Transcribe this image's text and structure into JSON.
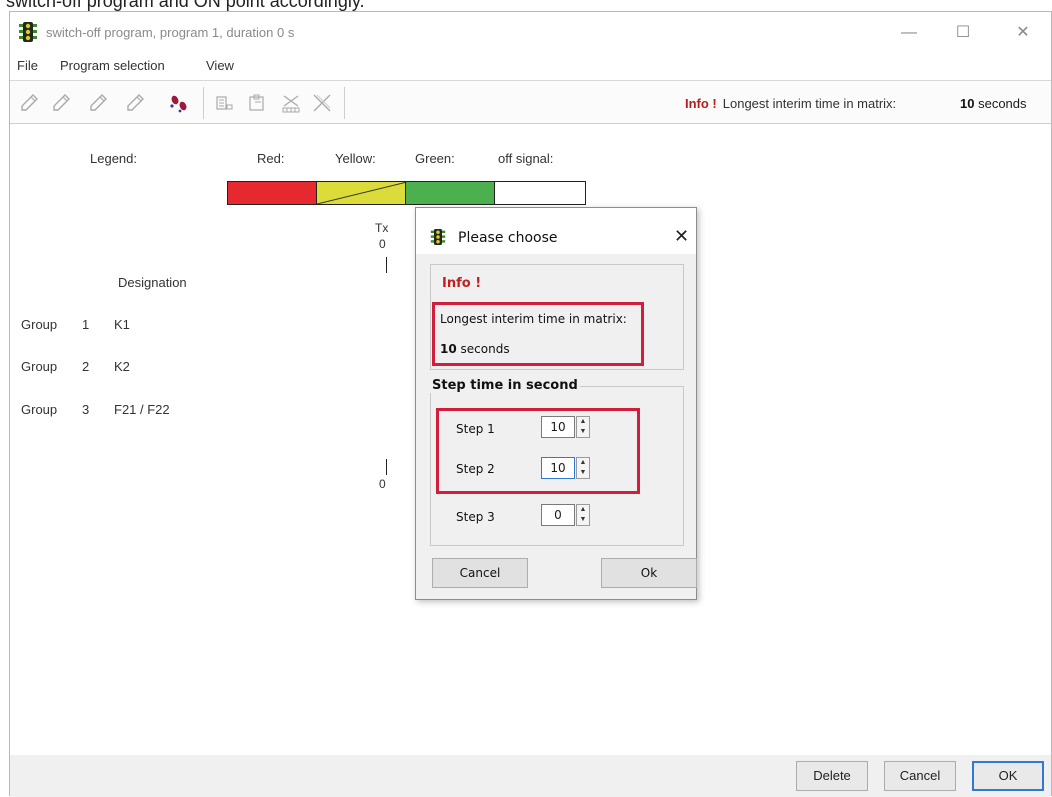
{
  "caption": "switch-off program and ON point accordingly.",
  "window": {
    "title": "switch-off program, program 1, duration 0 s",
    "icon": "traffic-light-icon",
    "controls": {
      "minimize": "—",
      "maximize": "☐",
      "close": "✕"
    }
  },
  "menu": {
    "items": [
      "File",
      "Program selection",
      "View"
    ]
  },
  "toolbar": {
    "icons": [
      "pen-icon",
      "pen-icon",
      "pen-icon",
      "pen-icon",
      "footsteps-icon",
      "copy-icon",
      "paste-icon",
      "delete-column-icon",
      "cut-icon"
    ],
    "info_label": "Info !",
    "info_text": "Longest interim time in matrix:",
    "info_value": "10",
    "info_unit": "seconds"
  },
  "legend": {
    "label": "Legend:",
    "red": "Red:",
    "yellow": "Yellow:",
    "green": "Green:",
    "off": "off signal:",
    "colors": {
      "red": "#e5292f",
      "yellow": "#dbdb3a",
      "green": "#4db04e",
      "off": "#ffffff"
    }
  },
  "axis": {
    "top_label": "Tx",
    "top_zero": "0",
    "bottom_zero": "0"
  },
  "table": {
    "designation_header": "Designation",
    "groups": [
      {
        "group": "Group",
        "number": "1",
        "name": "K1"
      },
      {
        "group": "Group",
        "number": "2",
        "name": "K2"
      },
      {
        "group": "Group",
        "number": "3",
        "name": "F21 / F22"
      }
    ]
  },
  "bottom_buttons": {
    "delete": "Delete",
    "cancel": "Cancel",
    "ok": "OK"
  },
  "dialog": {
    "title": "Please choose",
    "icon": "traffic-light-icon",
    "close": "✕",
    "info_label": "Info !",
    "info_text": "Longest interim time in matrix:",
    "info_value": "10",
    "info_unit": "seconds",
    "step_group_label": "Step time in second",
    "steps": [
      {
        "label": "Step 1",
        "value": "10"
      },
      {
        "label": "Step 2",
        "value": "10"
      },
      {
        "label": "Step 3",
        "value": "0"
      }
    ],
    "cancel": "Cancel",
    "ok": "Ok",
    "highlight_color": "#d11f3b"
  }
}
